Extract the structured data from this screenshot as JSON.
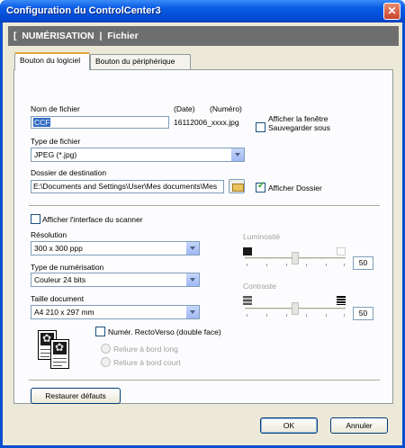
{
  "window": {
    "title": "Configuration du ControlCenter3",
    "close_glyph": "✕"
  },
  "header": {
    "section": "[  NUMÉRISATION  |  Fichier"
  },
  "tabs": [
    {
      "label": "Bouton du logiciel",
      "active": true
    },
    {
      "label": "Bouton du périphérique",
      "active": false
    }
  ],
  "file": {
    "name_label": "Nom de fichier",
    "date_label": "(Date)",
    "number_label": "(Numéro)",
    "name_value": "CCF",
    "generated_name": "16112006_xxxx.jpg",
    "show_save_as_label": "Afficher la fenêtre Sauvegarder sous",
    "show_save_as_checked": false,
    "type_label": "Type de fichier",
    "type_value": "JPEG (*.jpg)",
    "dest_label": "Dossier de destination",
    "dest_value": "E:\\Documents and Settings\\User\\Mes documents\\Mes",
    "show_folder_label": "Afficher Dossier",
    "show_folder_checked": true
  },
  "scanner": {
    "show_interface_label": "Afficher l'interface du scanner",
    "show_interface_checked": false,
    "resolution_label": "Résolution",
    "resolution_value": "300 x 300 ppp",
    "scan_type_label": "Type de numérisation",
    "scan_type_value": "Couleur 24 bits",
    "doc_size_label": "Taille document",
    "doc_size_value": "A4 210 x 297 mm",
    "duplex_label": "Numér. RectoVerso (double face)",
    "duplex_checked": false,
    "long_edge_label": "Reliure à bord long",
    "short_edge_label": "Reliure à bord court",
    "brightness_label": "Luminosité",
    "brightness_value": "50",
    "contrast_label": "Contraste",
    "contrast_value": "50"
  },
  "buttons": {
    "restore": "Restaurer défauts",
    "ok": "OK",
    "cancel": "Annuler"
  }
}
